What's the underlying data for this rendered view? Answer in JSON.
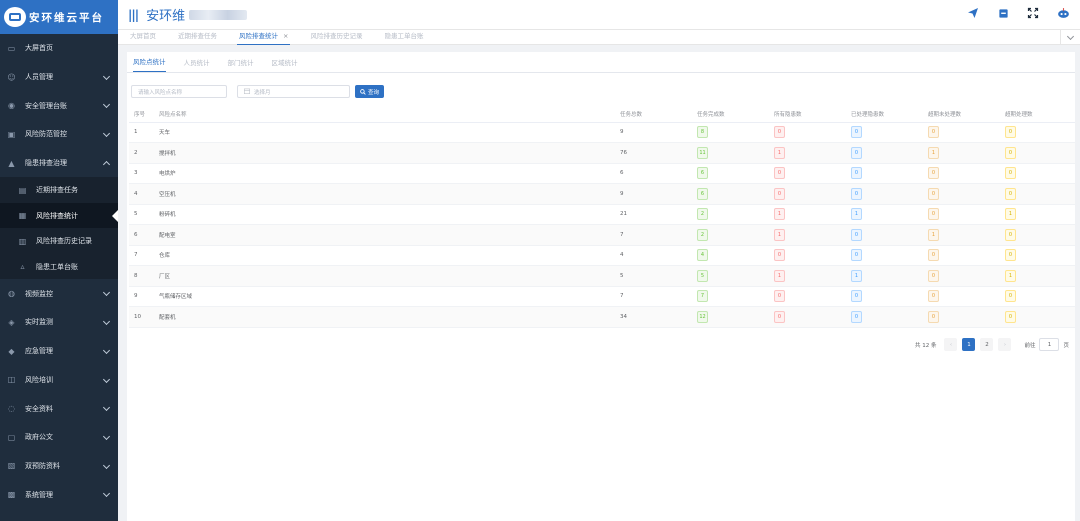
{
  "logo": {
    "text": "安环维云平台"
  },
  "header": {
    "title": "安环维",
    "icons": [
      "send-icon",
      "doc-icon",
      "fullscreen-icon",
      "robot-icon"
    ]
  },
  "sidebar": {
    "items": [
      {
        "label": "大屏首页",
        "icon": "screen-icon"
      },
      {
        "label": "人员管理",
        "icon": "user-icon",
        "chevron": true
      },
      {
        "label": "安全管理台账",
        "icon": "shield-icon",
        "chevron": true
      },
      {
        "label": "风险防范管控",
        "icon": "risk-icon",
        "chevron": true
      },
      {
        "label": "隐患排查治理",
        "icon": "warning-icon",
        "chevron": true,
        "expanded": true
      }
    ],
    "sub_items": [
      {
        "label": "近期排查任务",
        "icon": "task-icon"
      },
      {
        "label": "风险排查统计",
        "icon": "stats-icon",
        "active": true
      },
      {
        "label": "风险排查历史记录",
        "icon": "history-icon"
      },
      {
        "label": "隐患工单台账",
        "icon": "alert-icon"
      }
    ],
    "items_after": [
      {
        "label": "视频监控",
        "icon": "video-icon"
      },
      {
        "label": "实时监测",
        "icon": "monitor-icon"
      },
      {
        "label": "应急管理",
        "icon": "emergency-icon"
      },
      {
        "label": "风险培训",
        "icon": "training-icon"
      },
      {
        "label": "安全资料",
        "icon": "info-icon"
      },
      {
        "label": "政府公文",
        "icon": "gov-icon"
      },
      {
        "label": "双预防资料",
        "icon": "folder-icon"
      },
      {
        "label": "系统管理",
        "icon": "settings-icon"
      }
    ]
  },
  "tabs": [
    {
      "label": "大屏首页"
    },
    {
      "label": "近期排查任务"
    },
    {
      "label": "风险排查统计",
      "active": true,
      "close": "×"
    },
    {
      "label": "风险排查历史记录"
    },
    {
      "label": "隐患工单台账"
    }
  ],
  "subtabs": [
    {
      "label": "风险点统计",
      "active": true
    },
    {
      "label": "人员统计"
    },
    {
      "label": "部门统计"
    },
    {
      "label": "区域统计"
    }
  ],
  "filters": {
    "name_placeholder": "请输入风险点名称",
    "date_placeholder": "选择月",
    "query_label": "查询"
  },
  "table": {
    "headers": [
      "序号",
      "风险点名称",
      "任务总数",
      "任务完成数",
      "所有隐患数",
      "已处理隐患数",
      "超期未处理数",
      "超期处理数"
    ],
    "rows": [
      [
        "1",
        "天车",
        "9",
        "8",
        "0",
        "0",
        "0",
        "0"
      ],
      [
        "2",
        "搅拌机",
        "76",
        "11",
        "1",
        "0",
        "1",
        "0"
      ],
      [
        "3",
        "电烘炉",
        "6",
        "6",
        "0",
        "0",
        "0",
        "0"
      ],
      [
        "4",
        "空压机",
        "9",
        "6",
        "0",
        "0",
        "0",
        "0"
      ],
      [
        "5",
        "粉碎机",
        "21",
        "2",
        "1",
        "1",
        "0",
        "1"
      ],
      [
        "6",
        "配电室",
        "7",
        "2",
        "1",
        "0",
        "1",
        "0"
      ],
      [
        "7",
        "仓库",
        "4",
        "4",
        "0",
        "0",
        "0",
        "0"
      ],
      [
        "8",
        "厂区",
        "5",
        "5",
        "1",
        "1",
        "0",
        "1"
      ],
      [
        "9",
        "气瓶储存区域",
        "7",
        "7",
        "0",
        "0",
        "0",
        "0"
      ],
      [
        "10",
        "配套机",
        "34",
        "12",
        "0",
        "0",
        "0",
        "0"
      ]
    ]
  },
  "pagination": {
    "total_text": "共 12 条",
    "pages": [
      "1",
      "2"
    ],
    "current": "1",
    "goto_label": "前往",
    "goto_value": "1",
    "page_unit": "页"
  },
  "colors": {
    "primary": "#2e71c4",
    "sidebar_bg": "#1f2d3d",
    "green": "#67c23a",
    "red": "#f56c6c",
    "blue": "#409eff",
    "orange": "#e6a23c",
    "yellow": "#d4b106"
  }
}
